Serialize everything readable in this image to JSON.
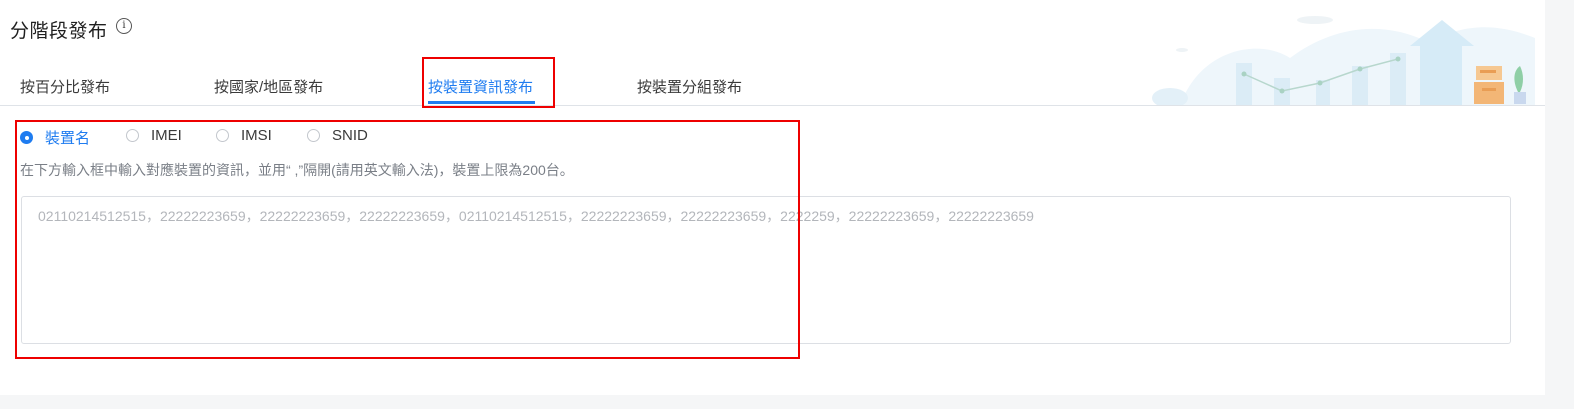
{
  "header": {
    "title": "分階段發布",
    "info_icon": "info-icon"
  },
  "tabs": [
    {
      "label": "按百分比發布",
      "active": false
    },
    {
      "label": "按國家/地區發布",
      "active": false
    },
    {
      "label": "按裝置資訊發布",
      "active": true
    },
    {
      "label": "按裝置分組發布",
      "active": false
    }
  ],
  "radios": [
    {
      "label": "裝置名",
      "checked": true
    },
    {
      "label": "IMEI",
      "checked": false
    },
    {
      "label": "IMSI",
      "checked": false
    },
    {
      "label": "SNID",
      "checked": false
    }
  ],
  "hint": "在下方輸入框中輸入對應裝置的資訊，並用“ ,”隔開(請用英文輸入法)，裝置上限為200台。",
  "textarea": {
    "placeholder": "02110214512515，22222223659，22222223659，22222223659，02110214512515，22222223659，22222223659，2222259，22222223659，22222223659"
  },
  "colors": {
    "accent": "#1f7cf0",
    "highlight": "#ee0000"
  }
}
